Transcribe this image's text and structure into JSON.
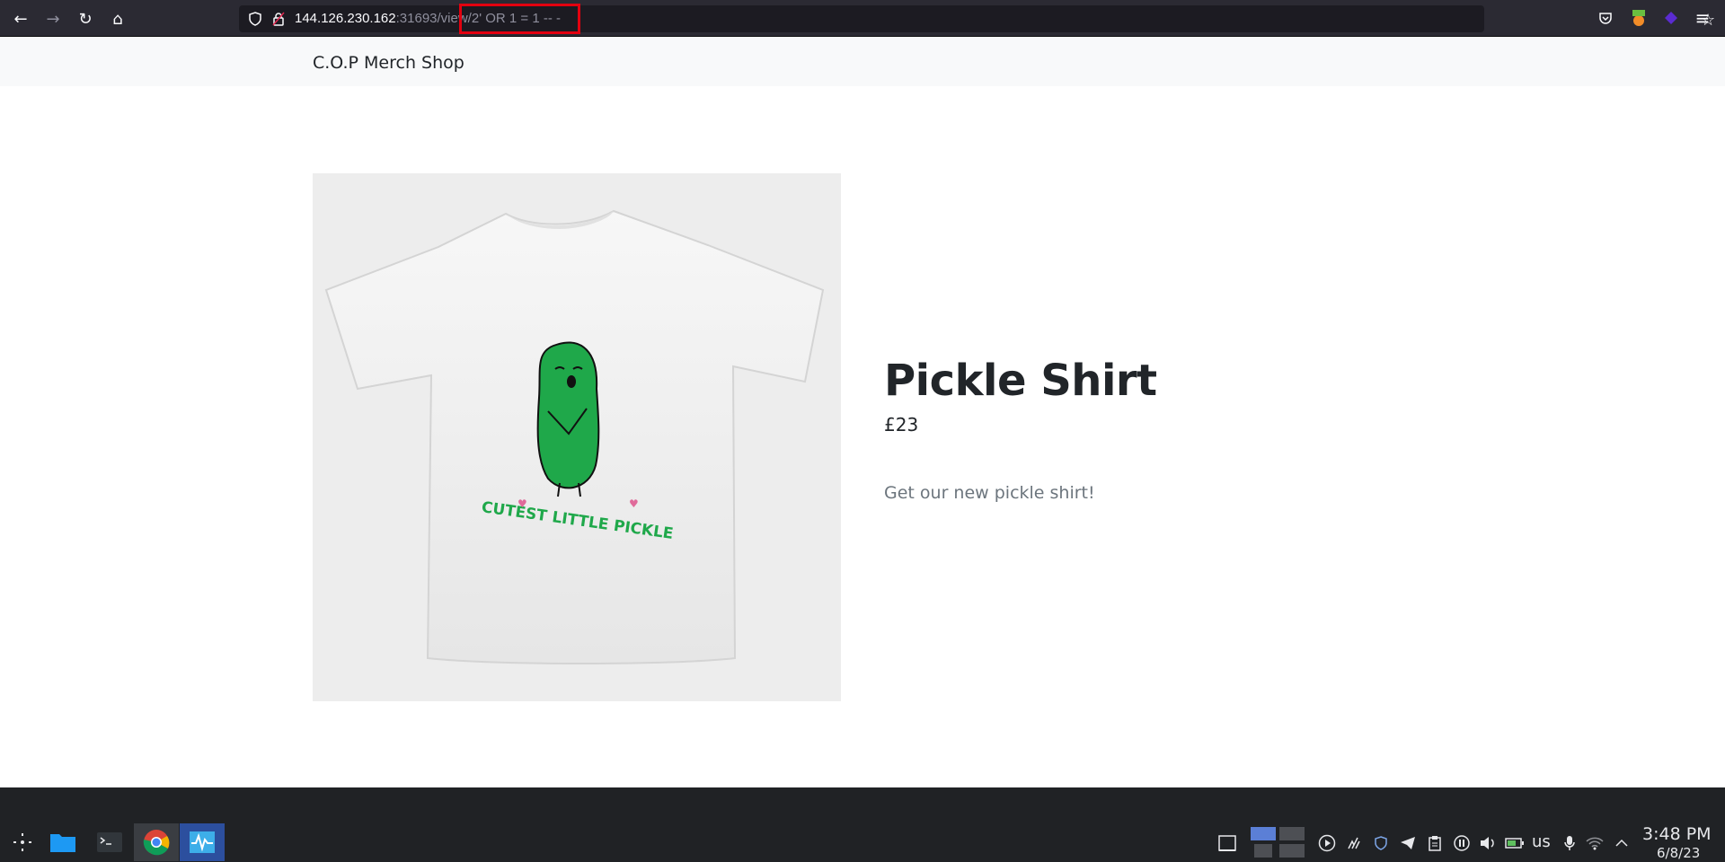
{
  "browser": {
    "url_host": "144.126.230.162",
    "url_rest": ":31693/view/2' OR 1 = 1 -- -",
    "nav": {
      "back_icon": "←",
      "forward_icon": "→",
      "reload_icon": "↻",
      "home_icon": "⌂"
    },
    "bookmark_icon": "☆",
    "menu_icon": "≡"
  },
  "site": {
    "brand": "C.O.P Merch Shop"
  },
  "product": {
    "title": "Pickle Shirt",
    "price": "£23",
    "description": "Get our new pickle shirt!",
    "shirt_print_text": "CUTEST LITTLE PICKLE"
  },
  "taskbar": {
    "language": "us",
    "time": "3:48 PM",
    "date": "6/8/23"
  },
  "colors": {
    "toolbar_bg": "#2b2a33",
    "urlbar_bg": "#1c1b22",
    "highlight": "#e3000f",
    "pickle_green": "#1fa84a",
    "taskbar_bg": "#202225"
  }
}
